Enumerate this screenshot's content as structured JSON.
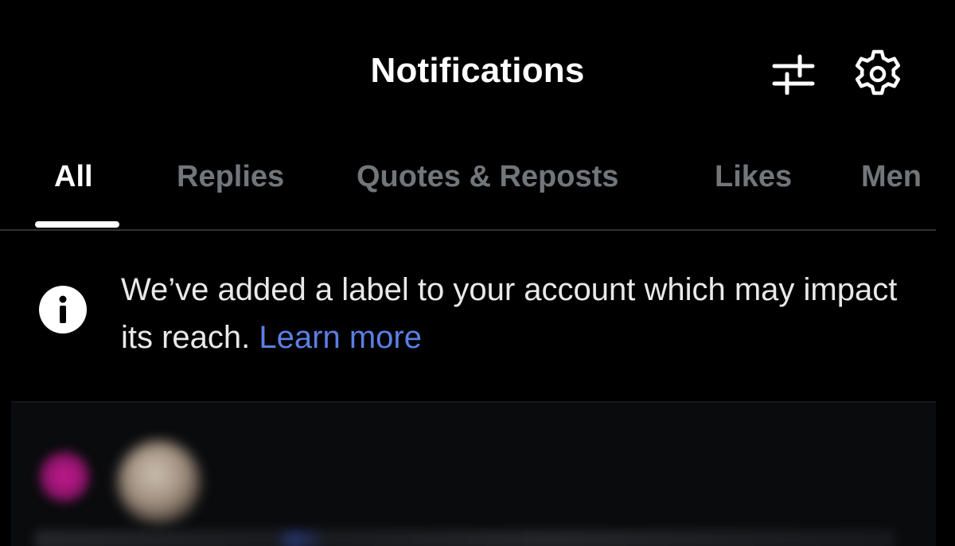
{
  "header": {
    "title": "Notifications",
    "filter_icon": "sliders-icon",
    "settings_icon": "gear-icon"
  },
  "tabs": [
    {
      "label": "All",
      "active": true
    },
    {
      "label": "Replies",
      "active": false
    },
    {
      "label": "Quotes & Reposts",
      "active": false
    },
    {
      "label": "Likes",
      "active": false
    },
    {
      "label": "Men",
      "active": false
    }
  ],
  "notice": {
    "icon": "info-icon",
    "text": "We’ve added a label to your account which may impact its reach.",
    "link_text": "Learn more"
  },
  "colors": {
    "background": "#000000",
    "text_primary": "#ffffff",
    "text_secondary": "#71767b",
    "link": "#5b7fe3",
    "divider": "#2f3336"
  }
}
